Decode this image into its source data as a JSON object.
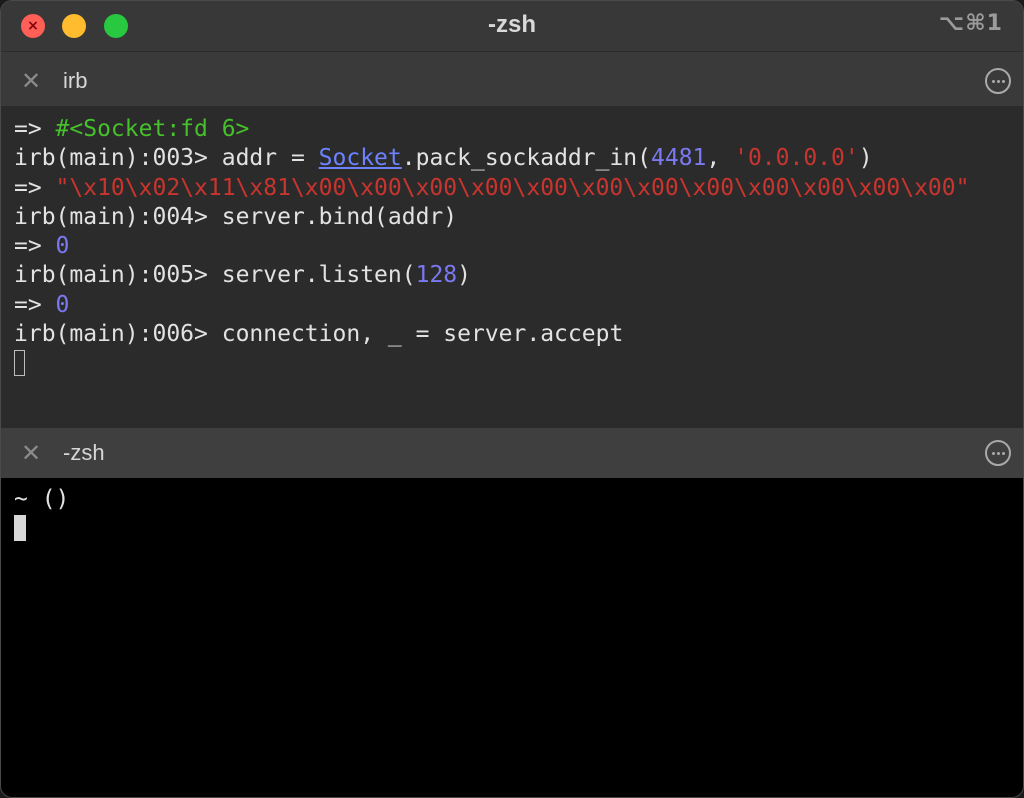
{
  "window": {
    "title": "-zsh",
    "shortcut": "⌥⌘1"
  },
  "panes": {
    "top": {
      "name": "irb",
      "lines": {
        "l1_arrow": "=> ",
        "l1_value": "#<Socket:fd 6>",
        "l2_prompt": "irb(main):003> ",
        "l2_code_a": "addr = ",
        "l2_socket": "Socket",
        "l2_code_b": ".pack_sockaddr_in(",
        "l2_port": "4481",
        "l2_comma": ", ",
        "l2_addr": "'0.0.0.0'",
        "l2_close": ")",
        "l3_arrow": "=> ",
        "l3_value": "\"\\x10\\x02\\x11\\x81\\x00\\x00\\x00\\x00\\x00\\x00\\x00\\x00\\x00\\x00\\x00\\x00\"",
        "l4_prompt": "irb(main):004> ",
        "l4_code": "server.bind(addr)",
        "l5_arrow": "=> ",
        "l5_value": "0",
        "l6_prompt": "irb(main):005> ",
        "l6_code_a": "server.listen(",
        "l6_num": "128",
        "l6_close": ")",
        "l7_arrow": "=> ",
        "l7_value": "0",
        "l8_prompt": "irb(main):006> ",
        "l8_code": "connection, _ = server.accept"
      }
    },
    "bottom": {
      "name": "-zsh",
      "prompt": "~ ()"
    }
  },
  "colors": {
    "green": "#46c02b",
    "red": "#c9352e",
    "blue": "#7b79f2",
    "link": "#6d82ff"
  },
  "icons": {
    "close": "close-icon",
    "more": "more-options-icon"
  }
}
